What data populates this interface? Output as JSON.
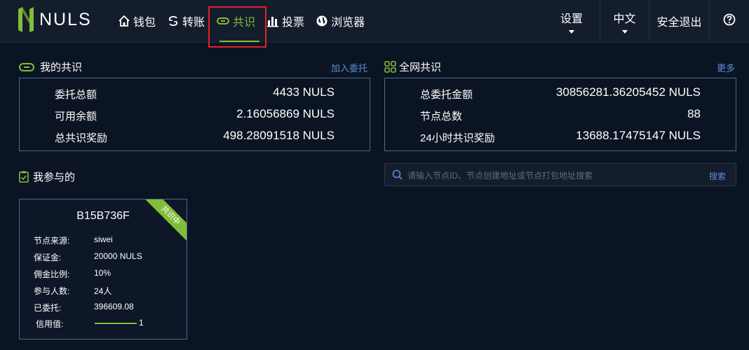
{
  "brand": {
    "logo_text": "NULS",
    "accent_color": "#82bd39"
  },
  "nav": {
    "items": [
      {
        "label": "钱包",
        "icon": "home-icon"
      },
      {
        "label": "转账",
        "icon": "transfer-icon"
      },
      {
        "label": "共识",
        "icon": "link-icon",
        "active": true
      },
      {
        "label": "投票",
        "icon": "bar-chart-icon"
      },
      {
        "label": "浏览器",
        "icon": "globe-icon"
      }
    ],
    "right": {
      "settings": "设置",
      "language": "中文",
      "logout": "安全退出",
      "help_icon": "help-icon"
    }
  },
  "my_consensus": {
    "title": "我的共识",
    "link": "加入委托",
    "rows": [
      {
        "label": "委托总额",
        "value": "4433 NULS"
      },
      {
        "label": "可用余额",
        "value": "2.16056869 NULS"
      },
      {
        "label": "总共识奖励",
        "value": "498.28091518 NULS"
      }
    ]
  },
  "network_consensus": {
    "title": "全网共识",
    "link": "更多",
    "rows": [
      {
        "label": "总委托金额",
        "value": "30856281.36205452 NULS"
      },
      {
        "label": "节点总数",
        "value": "88"
      },
      {
        "label": "24小时共识奖励",
        "value": "13688.17475147 NULS"
      }
    ]
  },
  "participated": {
    "title": "我参与的"
  },
  "search": {
    "placeholder": "请输入节点ID、节点创建地址或节点打包地址搜索",
    "button": "搜索"
  },
  "node_card": {
    "id": "B15B736F",
    "status": "共识中",
    "fields": [
      {
        "label": "节点来源:",
        "value": "siwei"
      },
      {
        "label": "保证金:",
        "value": "20000 NULS"
      },
      {
        "label": "佣金比例:",
        "value": "10%"
      },
      {
        "label": "参与人数:",
        "value": "24人"
      },
      {
        "label": "已委托:",
        "value": "396609.08"
      }
    ],
    "credit": {
      "label": "信用值:",
      "value": "1"
    }
  }
}
